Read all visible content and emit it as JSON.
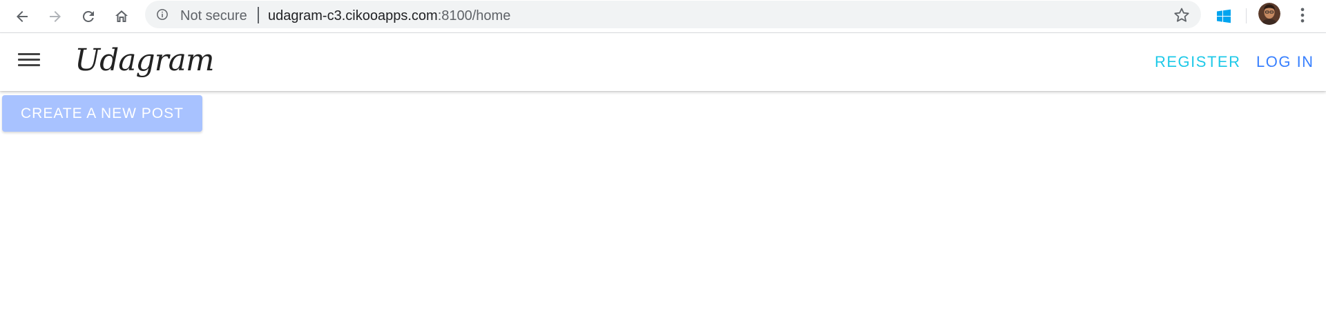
{
  "browser": {
    "security_label": "Not secure",
    "url_host": "udagram-c3.cikooapps.com",
    "url_rest": ":8100/home",
    "icons": {
      "back": "back-arrow-icon",
      "forward": "forward-arrow-icon",
      "reload": "reload-icon",
      "home": "home-icon",
      "info": "info-icon",
      "bookmark": "star-icon",
      "extension": "windows-logo-icon",
      "profile": "avatar",
      "menu": "three-dots-icon"
    },
    "colors": {
      "omnibox_bg": "#f1f3f4",
      "extension_blue": "#00a4ef"
    }
  },
  "app": {
    "title": "Udagram",
    "nav": {
      "register": "REGISTER",
      "login": "LOG IN"
    },
    "colors": {
      "register": "#1ec9e8",
      "login": "#3880ff",
      "button_bg": "#a8c2ff"
    }
  },
  "content": {
    "create_post_label": "CREATE A NEW POST"
  }
}
